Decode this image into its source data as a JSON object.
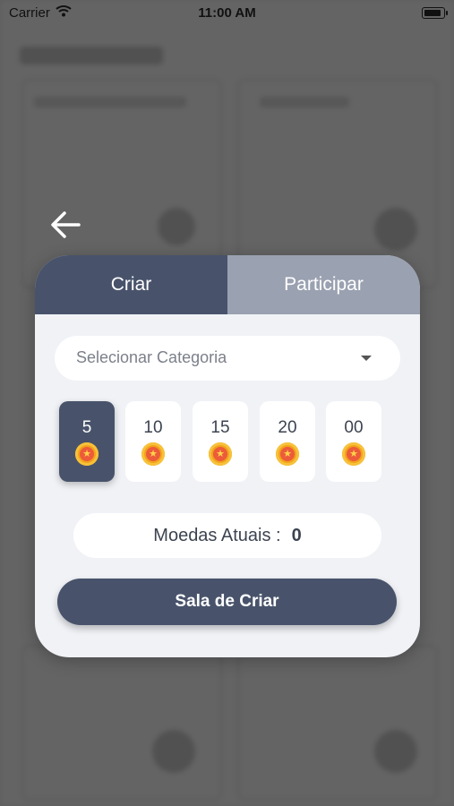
{
  "status_bar": {
    "carrier": "Carrier",
    "time": "11:00 AM"
  },
  "modal": {
    "tabs": [
      {
        "label": "Criar",
        "active": true
      },
      {
        "label": "Participar",
        "active": false
      }
    ],
    "category_select": {
      "value": "Selecionar Categoria",
      "icon": "chevron-down-icon"
    },
    "coin_options": [
      {
        "label": "5",
        "selected": true
      },
      {
        "label": "10",
        "selected": false
      },
      {
        "label": "15",
        "selected": false
      },
      {
        "label": "20",
        "selected": false
      },
      {
        "label": "00",
        "selected": false
      }
    ],
    "balance": {
      "label": "Moedas Atuais :",
      "value": "0"
    },
    "create_button_label": "Sala de Criar"
  },
  "colors": {
    "primary": "#48536b",
    "tab_inactive": "#9aa1b1",
    "modal_bg": "#f0f2f6",
    "coin": "#f2a21b"
  }
}
